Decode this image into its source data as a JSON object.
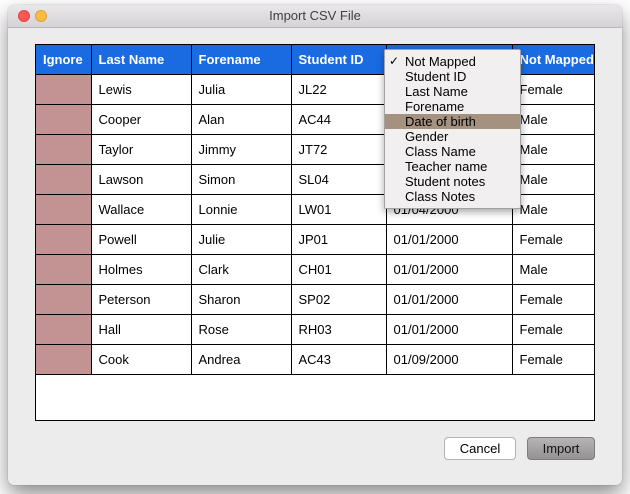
{
  "window": {
    "title": "Import CSV File"
  },
  "table": {
    "headers": [
      "Ignore",
      "Last Name",
      "Forename",
      "Student ID",
      "",
      "Not Mapped"
    ],
    "rows": [
      {
        "last_name": "Lewis",
        "forename": "Julia",
        "student_id": "JL22",
        "dob": "",
        "gender": "Female"
      },
      {
        "last_name": "Cooper",
        "forename": "Alan",
        "student_id": "AC44",
        "dob": "",
        "gender": "Male"
      },
      {
        "last_name": "Taylor",
        "forename": "Jimmy",
        "student_id": "JT72",
        "dob": "",
        "gender": "Male"
      },
      {
        "last_name": "Lawson",
        "forename": "Simon",
        "student_id": "SL04",
        "dob": "",
        "gender": "Male"
      },
      {
        "last_name": "Wallace",
        "forename": "Lonnie",
        "student_id": "LW01",
        "dob": "01/04/2000",
        "gender": "Male"
      },
      {
        "last_name": "Powell",
        "forename": "Julie",
        "student_id": "JP01",
        "dob": "01/01/2000",
        "gender": "Female"
      },
      {
        "last_name": "Holmes",
        "forename": "Clark",
        "student_id": "CH01",
        "dob": "01/01/2000",
        "gender": "Male"
      },
      {
        "last_name": "Peterson",
        "forename": "Sharon",
        "student_id": "SP02",
        "dob": "01/01/2000",
        "gender": "Female"
      },
      {
        "last_name": "Hall",
        "forename": "Rose",
        "student_id": "RH03",
        "dob": "01/01/2000",
        "gender": "Female"
      },
      {
        "last_name": "Cook",
        "forename": "Andrea",
        "student_id": "AC43",
        "dob": "01/09/2000",
        "gender": "Female"
      }
    ]
  },
  "menu": {
    "check_glyph": "✓",
    "items": [
      {
        "label": "Not Mapped",
        "checked": true
      },
      {
        "label": "Student ID"
      },
      {
        "label": "Last Name"
      },
      {
        "label": "Forename"
      },
      {
        "label": "Date of birth",
        "highlighted": true
      },
      {
        "label": "Gender"
      },
      {
        "label": "Class Name"
      },
      {
        "label": "Teacher name"
      },
      {
        "label": "Student notes"
      },
      {
        "label": "Class Notes"
      }
    ]
  },
  "buttons": {
    "cancel": "Cancel",
    "import": "Import"
  },
  "colors": {
    "header_blue": "#1a6be1",
    "ignore_cell": "#c29392",
    "menu_highlight": "#a5917f"
  }
}
